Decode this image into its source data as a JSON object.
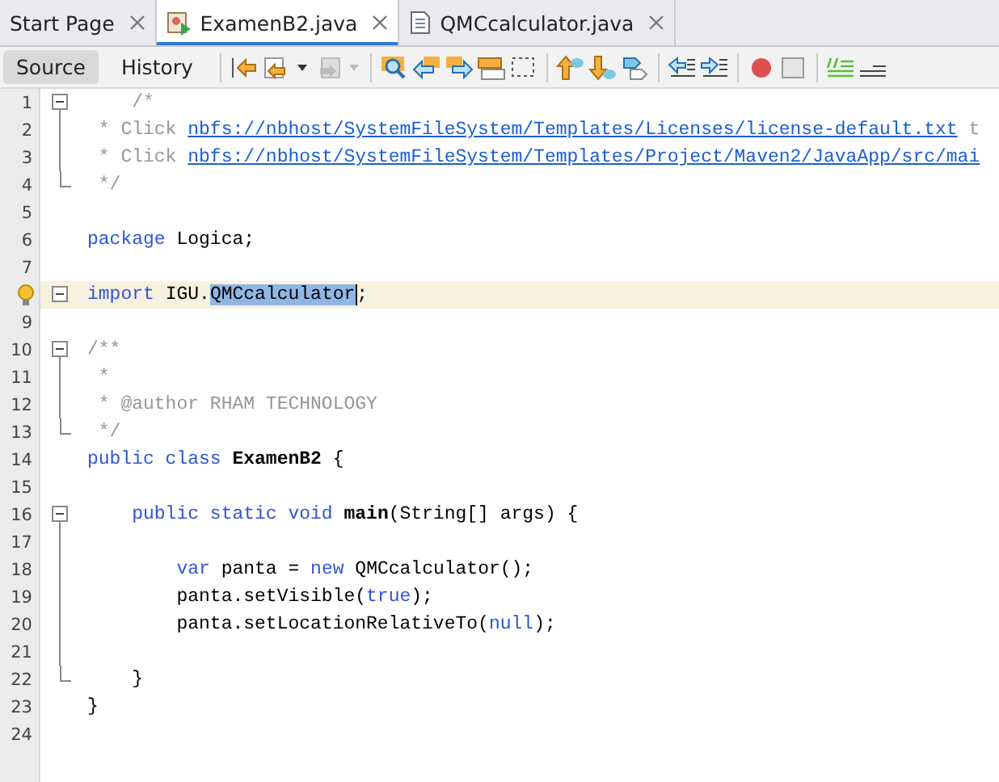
{
  "tabs": [
    {
      "label": "Start Page",
      "selected": false,
      "kind": "page"
    },
    {
      "label": "ExamenB2.java",
      "selected": true,
      "kind": "class"
    },
    {
      "label": "QMCcalculator.java",
      "selected": false,
      "kind": "file"
    }
  ],
  "view_tabs": [
    {
      "label": "Source",
      "selected": true
    },
    {
      "label": "History",
      "selected": false
    }
  ],
  "lines": [
    {
      "number": "1",
      "current": false,
      "kind": "fold-start",
      "tokens": [
        {
          "kind": "comment",
          "text": "    /*"
        }
      ]
    },
    {
      "number": "2",
      "current": false,
      "kind": "fold-inner",
      "tokens": [
        {
          "kind": "comment",
          "text": " * Click "
        },
        {
          "kind": "link",
          "text": "nbfs://nbhost/SystemFileSystem/Templates/Licenses/license-default.txt"
        },
        {
          "kind": "comment",
          "text": " t"
        }
      ]
    },
    {
      "number": "3",
      "current": false,
      "kind": "fold-inner",
      "tokens": [
        {
          "kind": "comment",
          "text": " * Click "
        },
        {
          "kind": "link",
          "text": "nbfs://nbhost/SystemFileSystem/Templates/Project/Maven2/JavaApp/src/mai"
        }
      ]
    },
    {
      "number": "4",
      "current": false,
      "kind": "fold-end",
      "tokens": [
        {
          "kind": "comment",
          "text": " */"
        }
      ]
    },
    {
      "number": "5",
      "current": false,
      "kind": "plain"
    },
    {
      "number": "6",
      "current": false,
      "kind": "plain",
      "tokens": [
        {
          "kind": "keyword",
          "text": "package"
        },
        {
          "kind": "plain",
          "text": " Logica;"
        }
      ]
    },
    {
      "number": "7",
      "current": false,
      "kind": "plain"
    },
    {
      "current": true,
      "kind": "fold-single",
      "hint": true,
      "tokens": [
        {
          "kind": "keyword",
          "text": "import"
        },
        {
          "kind": "plain",
          "text": " IGU."
        },
        {
          "kind": "selected",
          "text": "QMCcalculator"
        },
        {
          "kind": "plain",
          "text": ";"
        }
      ]
    },
    {
      "number": "9",
      "current": false,
      "kind": "plain"
    },
    {
      "number": "10",
      "current": false,
      "kind": "fold-start",
      "tokens": [
        {
          "kind": "comment",
          "text": "/**"
        }
      ]
    },
    {
      "number": "11",
      "current": false,
      "kind": "fold-inner",
      "tokens": [
        {
          "kind": "comment",
          "text": " *"
        }
      ]
    },
    {
      "number": "12",
      "current": false,
      "kind": "fold-inner",
      "tokens": [
        {
          "kind": "comment",
          "text": " * @author RHAM TECHNOLOGY"
        }
      ]
    },
    {
      "number": "13",
      "current": false,
      "kind": "fold-end",
      "tokens": [
        {
          "kind": "comment",
          "text": " */"
        }
      ]
    },
    {
      "number": "14",
      "current": false,
      "kind": "plain",
      "tokens": [
        {
          "kind": "keyword",
          "text": "public class "
        },
        {
          "kind": "bold",
          "text": "ExamenB2"
        },
        {
          "kind": "plain",
          "text": " {"
        }
      ]
    },
    {
      "number": "15",
      "current": false,
      "kind": "plain"
    },
    {
      "number": "16",
      "current": false,
      "kind": "fold-start",
      "tokens": [
        {
          "kind": "keyword",
          "text": "    public static void "
        },
        {
          "kind": "bold",
          "text": "main"
        },
        {
          "kind": "plain",
          "text": "(String[] args) {"
        }
      ]
    },
    {
      "number": "17",
      "current": false,
      "kind": "fold-inner"
    },
    {
      "number": "18",
      "current": false,
      "kind": "fold-inner",
      "tokens": [
        {
          "kind": "keyword",
          "text": "        var"
        },
        {
          "kind": "plain",
          "text": " panta = "
        },
        {
          "kind": "keyword",
          "text": "new"
        },
        {
          "kind": "plain",
          "text": " QMCcalculator();"
        }
      ]
    },
    {
      "number": "19",
      "current": false,
      "kind": "fold-inner",
      "tokens": [
        {
          "kind": "plain",
          "text": "        panta.setVisible("
        },
        {
          "kind": "keyword",
          "text": "true"
        },
        {
          "kind": "plain",
          "text": ");"
        }
      ]
    },
    {
      "number": "20",
      "current": false,
      "kind": "fold-inner",
      "tokens": [
        {
          "kind": "plain",
          "text": "        panta.setLocationRelativeTo("
        },
        {
          "kind": "keyword",
          "text": "null"
        },
        {
          "kind": "plain",
          "text": ");"
        }
      ]
    },
    {
      "number": "21",
      "current": false,
      "kind": "fold-inner"
    },
    {
      "number": "22",
      "current": false,
      "kind": "fold-end",
      "tokens": [
        {
          "kind": "plain",
          "text": "    }"
        }
      ]
    },
    {
      "number": "23",
      "current": false,
      "kind": "plain",
      "tokens": [
        {
          "kind": "plain",
          "text": "}"
        }
      ]
    },
    {
      "number": "24",
      "current": false,
      "kind": "plain"
    }
  ]
}
